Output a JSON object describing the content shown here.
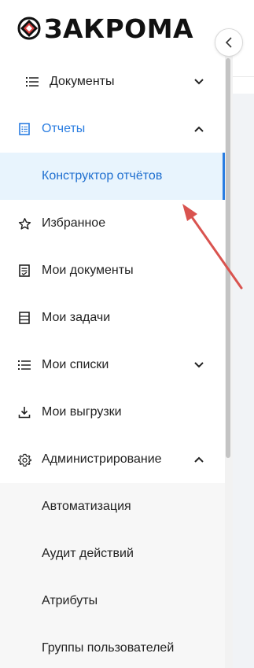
{
  "logo": {
    "text": "ЗАКРОМА"
  },
  "menu": {
    "documents": {
      "label": "Документы"
    },
    "reports": {
      "label": "Отчеты"
    },
    "report_builder": {
      "label": "Конструктор отчётов"
    },
    "favorites": {
      "label": "Избранное"
    },
    "my_documents": {
      "label": "Мои документы"
    },
    "my_tasks": {
      "label": "Мои задачи"
    },
    "my_lists": {
      "label": "Мои списки"
    },
    "my_exports": {
      "label": "Мои выгрузки"
    },
    "administration": {
      "label": "Администрирование"
    },
    "automation": {
      "label": "Автоматизация"
    },
    "audit": {
      "label": "Аудит действий"
    },
    "attributes": {
      "label": "Атрибуты"
    },
    "user_groups": {
      "label": "Группы пользователей"
    }
  },
  "colors": {
    "accent": "#2a7de1",
    "selected_bg": "#e8f4fd",
    "annotation_arrow": "#d9534f"
  }
}
